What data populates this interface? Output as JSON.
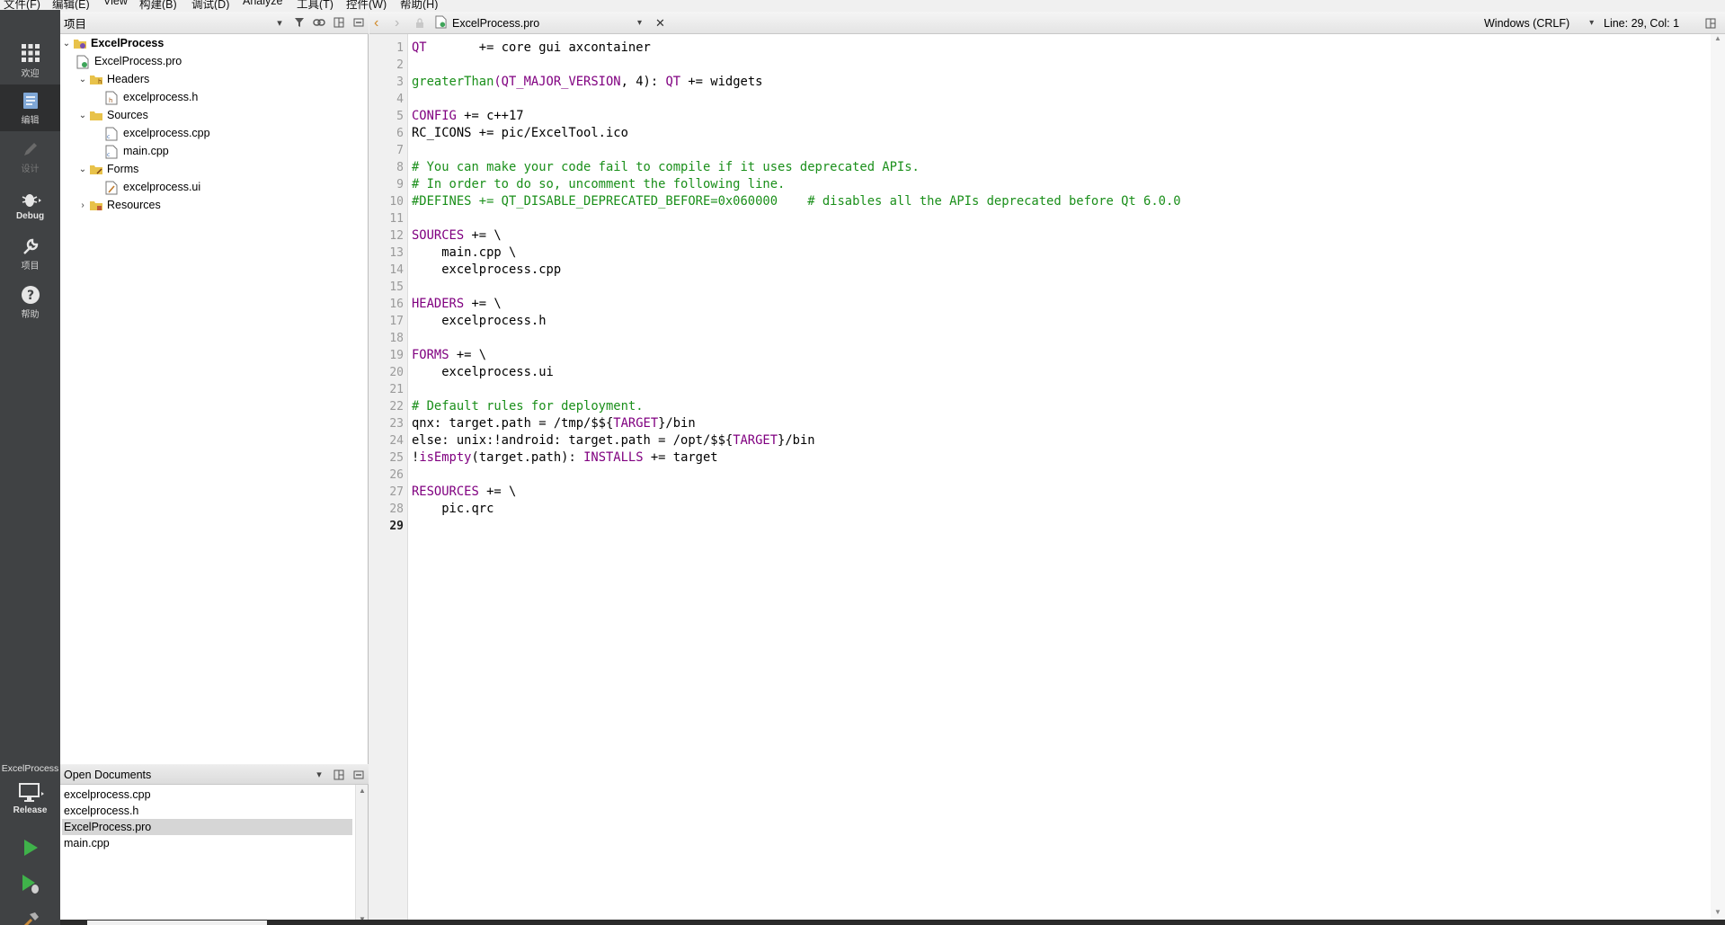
{
  "menubar": {
    "items": [
      "文件(F)",
      "编辑(E)",
      "View",
      "构建(B)",
      "调试(D)",
      "Analyze",
      "工具(T)",
      "控件(W)",
      "帮助(H)"
    ]
  },
  "modes": {
    "welcome": "欢迎",
    "edit": "编辑",
    "design": "设计",
    "debug": "Debug",
    "projects": "项目",
    "help": "帮助"
  },
  "kit": {
    "project": "ExcelProcess",
    "build_config": "Release"
  },
  "project_pane": {
    "title": "项目",
    "tree": [
      {
        "label": "ExcelProcess",
        "level": 0,
        "expanded": true,
        "type": "project"
      },
      {
        "label": "ExcelProcess.pro",
        "level": 1,
        "type": "pro"
      },
      {
        "label": "Headers",
        "level": 1,
        "expanded": true,
        "type": "folder"
      },
      {
        "label": "excelprocess.h",
        "level": 2,
        "type": "h"
      },
      {
        "label": "Sources",
        "level": 1,
        "expanded": true,
        "type": "folder"
      },
      {
        "label": "excelprocess.cpp",
        "level": 2,
        "type": "cpp"
      },
      {
        "label": "main.cpp",
        "level": 2,
        "type": "cpp"
      },
      {
        "label": "Forms",
        "level": 1,
        "expanded": true,
        "type": "folder"
      },
      {
        "label": "excelprocess.ui",
        "level": 2,
        "type": "ui"
      },
      {
        "label": "Resources",
        "level": 1,
        "expanded": false,
        "type": "resfolder"
      }
    ]
  },
  "open_documents": {
    "title": "Open Documents",
    "items": [
      "excelprocess.cpp",
      "excelprocess.h",
      "ExcelProcess.pro",
      "main.cpp"
    ],
    "selected": "ExcelProcess.pro"
  },
  "editor_toolbar": {
    "file": "ExcelProcess.pro",
    "line_ending": "Windows (CRLF)",
    "cursor": "Line: 29, Col: 1"
  },
  "editor": {
    "current_line": 29,
    "lines": [
      [
        [
          "kw",
          "QT"
        ],
        [
          "t",
          "       += core gui axcontainer"
        ]
      ],
      [],
      [
        [
          "cm",
          "greaterThan"
        ],
        [
          "kw",
          "(QT_MAJOR_VERSION"
        ],
        [
          "t",
          ", 4): "
        ],
        [
          "kw",
          "QT"
        ],
        [
          "t",
          " += widgets"
        ]
      ],
      [],
      [
        [
          "kw",
          "CONFIG"
        ],
        [
          "t",
          " += c++17"
        ]
      ],
      [
        [
          "t",
          "RC_ICONS += pic/ExcelTool.ico"
        ]
      ],
      [],
      [
        [
          "cm",
          "# You can make your code fail to compile if it uses deprecated APIs."
        ]
      ],
      [
        [
          "cm",
          "# In order to do so, uncomment the following line."
        ]
      ],
      [
        [
          "cm",
          "#DEFINES += QT_DISABLE_DEPRECATED_BEFORE=0x060000    # disables all the APIs deprecated before Qt 6.0.0"
        ]
      ],
      [],
      [
        [
          "kw",
          "SOURCES"
        ],
        [
          "t",
          " += \\"
        ]
      ],
      [
        [
          "t",
          "    main.cpp \\"
        ]
      ],
      [
        [
          "t",
          "    excelprocess.cpp"
        ]
      ],
      [],
      [
        [
          "kw",
          "HEADERS"
        ],
        [
          "t",
          " += \\"
        ]
      ],
      [
        [
          "t",
          "    excelprocess.h"
        ]
      ],
      [],
      [
        [
          "kw",
          "FORMS"
        ],
        [
          "t",
          " += \\"
        ]
      ],
      [
        [
          "t",
          "    excelprocess.ui"
        ]
      ],
      [],
      [
        [
          "cm",
          "# Default rules for deployment."
        ]
      ],
      [
        [
          "t",
          "qnx: target.path = /tmp/$${"
        ],
        [
          "kw",
          "TARGET"
        ],
        [
          "t",
          "}/bin"
        ]
      ],
      [
        [
          "t",
          "else: unix:!android: target.path = /opt/$${"
        ],
        [
          "kw",
          "TARGET"
        ],
        [
          "t",
          "}/bin"
        ]
      ],
      [
        [
          "t",
          "!"
        ],
        [
          "kw",
          "isEmpty"
        ],
        [
          "t",
          "(target.path): "
        ],
        [
          "kw",
          "INSTALLS"
        ],
        [
          "t",
          " += target"
        ]
      ],
      [],
      [
        [
          "kw",
          "RESOURCES"
        ],
        [
          "t",
          " += \\"
        ]
      ],
      [
        [
          "t",
          "    pic.qrc"
        ]
      ],
      []
    ]
  }
}
